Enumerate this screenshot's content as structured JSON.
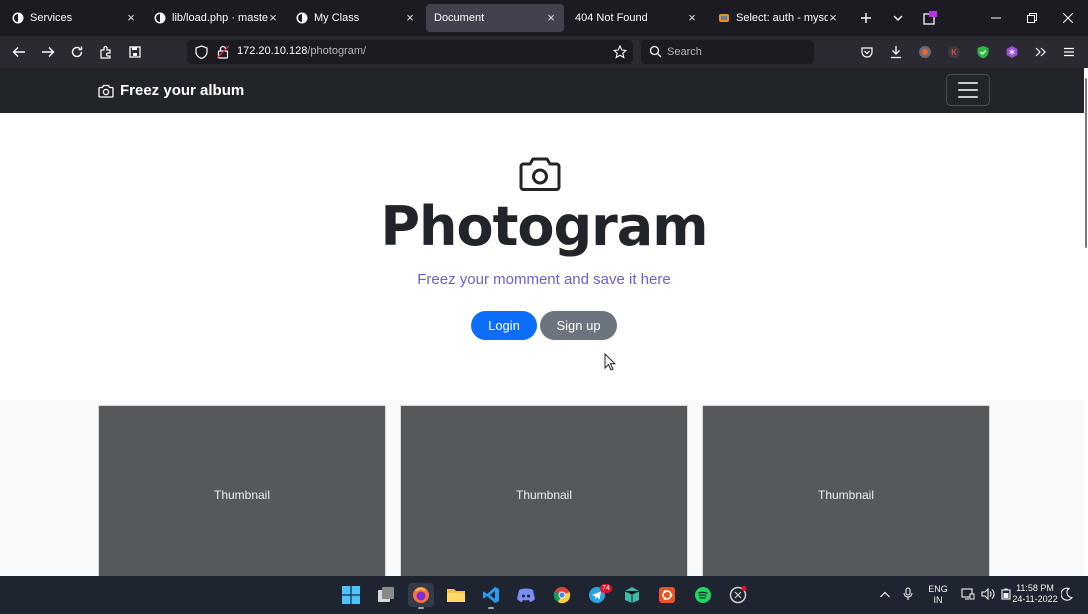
{
  "browser": {
    "tabs": [
      {
        "title": "Services",
        "active": false
      },
      {
        "title": "lib/load.php · master ·",
        "active": false
      },
      {
        "title": "My Class",
        "active": false
      },
      {
        "title": "Document",
        "active": true
      },
      {
        "title": "404 Not Found",
        "active": false
      },
      {
        "title": "Select: auth - mysql.se",
        "active": false
      }
    ],
    "url_host": "172.20.10.128",
    "url_path": "/photogram/",
    "search_placeholder": "Search"
  },
  "site": {
    "brand": "Freez your album",
    "hero_title": "Photogram",
    "hero_subtitle": "Freez your momment and save it here",
    "login_label": "Login",
    "signup_label": "Sign up",
    "thumbnails": [
      "Thumbnail",
      "Thumbnail",
      "Thumbnail"
    ]
  },
  "taskbar": {
    "telegram_badge": "74",
    "lang_top": "ENG",
    "lang_bottom": "IN",
    "time": "11:58 PM",
    "date": "24-11-2022"
  },
  "colors": {
    "primary": "#0d6efd",
    "secondary": "#6c757d",
    "subtitle": "#6f5ed3",
    "header": "#212529",
    "card": "#55595c"
  }
}
